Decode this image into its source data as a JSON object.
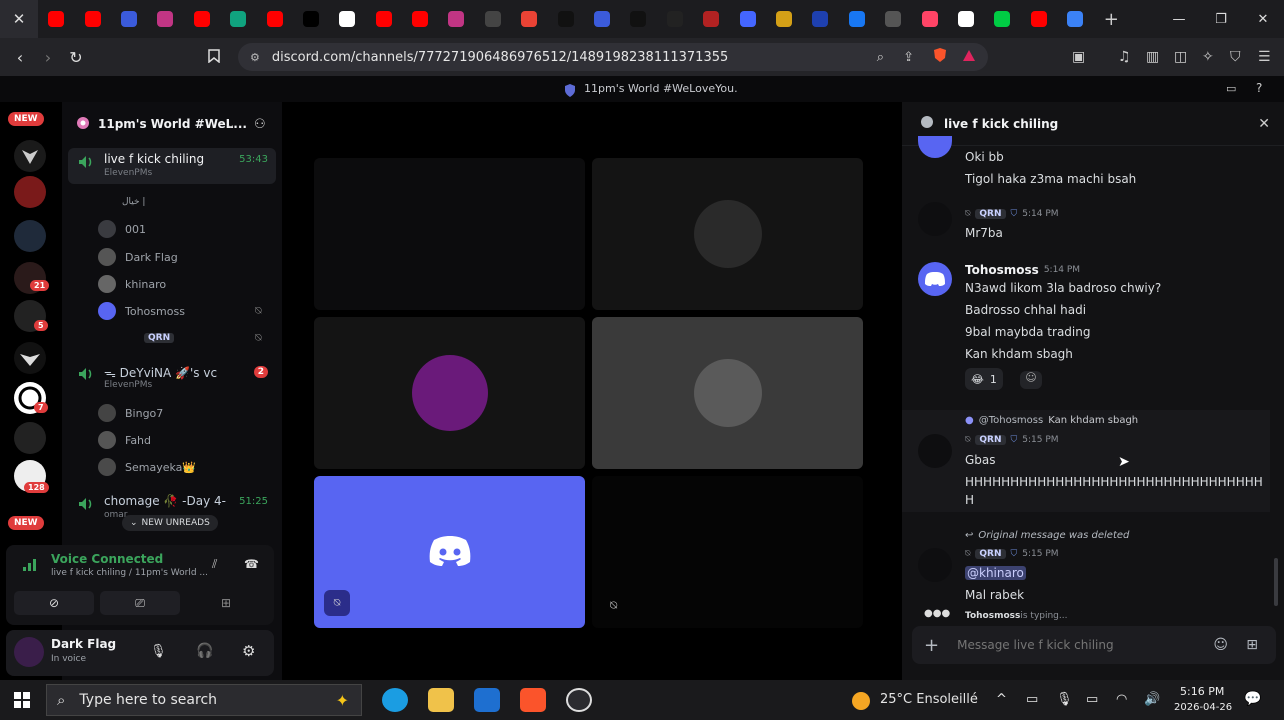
{
  "browser": {
    "url": "discord.com/channels/777271906486976512/1489198238111371355",
    "new_tab_glyph": "+",
    "tab_favicon_colors": [
      "#ff0000",
      "#ff0000",
      "#3b5bdb",
      "#c13584",
      "#ff0000",
      "#10a37f",
      "#ff0000",
      "#000000",
      "#ffffff",
      "#ff0000",
      "#ff0000",
      "#c13584",
      "#444444",
      "#ea4335",
      "#111111",
      "#3b5bdb",
      "#111111",
      "#222222",
      "#b22222",
      "#4466ff",
      "#d4a017",
      "#1e40af",
      "#1877f2",
      "#555555",
      "#ff4466",
      "#ffffff",
      "#00cc44",
      "#ff0000",
      "#3b82f6"
    ]
  },
  "discord_top": {
    "server_title": "11pm's World #WeLoveYou."
  },
  "rail": {
    "new_top": "NEW",
    "new_bottom": "NEW",
    "badges": [
      "21",
      "5",
      "7",
      "128"
    ]
  },
  "sidebar": {
    "server_name": "11pm's World #WeL...",
    "channels": [
      {
        "name": "live f kick chiling",
        "sub": "ElevenPMs",
        "time": "53:43",
        "members": [
          "خيال |",
          "001",
          "Dark Flag",
          "khinaro",
          "Tohosmoss",
          "QRN"
        ]
      },
      {
        "name": "ᯓ DeYviNA 🚀's vc",
        "sub": "ElevenPMs",
        "badge": "2",
        "members": [
          "Bingo7",
          "Fahd",
          "Semayeka👑"
        ]
      },
      {
        "name": "chomage 🥀 -Day 4-",
        "sub": "omar",
        "time": "51:25"
      }
    ],
    "new_unreads": "NEW UNREADS"
  },
  "voice_panel": {
    "status": "Voice Connected",
    "channel": "live f kick chiling / 11pm's World ..."
  },
  "user_panel": {
    "name": "Dark Flag",
    "status": "In voice"
  },
  "chat": {
    "title": "live f kick chiling",
    "tag": "QRN",
    "messages": {
      "m1_line1": "Oki bb",
      "m1_line2": "Tigol haka z3ma machi bsah",
      "m2_time": "5:14 PM",
      "m2_text": "Mr7ba",
      "m3_author": "Tohosmoss",
      "m3_time": "5:14 PM",
      "m3_lines": [
        "N3awd likom 3la badroso chwiy?",
        "Badrosso chhal hadi",
        "9bal maybda trading",
        "Kan khdam sbagh"
      ],
      "m3_reaction_emoji": "😂",
      "m3_reaction_count": "1",
      "m4_reply_mention": "@Tohosmoss",
      "m4_reply_text": "Kan khdam sbagh",
      "m4_time": "5:15 PM",
      "m4_line1": "Gbas",
      "m4_line2": "HHHHHHHHHHHHHHHHHHHHHHHHHHHHHHHHH",
      "m4_line3": "H",
      "m5_reply": "Original message was deleted",
      "m5_time": "5:15 PM",
      "m5_mention": "@khinaro",
      "m5_text": "Mal rabek"
    },
    "typing_user": "Tohosmoss",
    "typing_suffix": " is typing...",
    "input_placeholder": "Message live f kick chiling"
  },
  "taskbar": {
    "search_placeholder": "Type here to search",
    "weather": "25°C Ensoleillé",
    "time": "5:16 PM",
    "date": "2026-04-26"
  },
  "colors": {
    "discord_blurple": "#5865f2",
    "voice_green": "#3ba55c",
    "badge_red": "#e03c3c"
  }
}
